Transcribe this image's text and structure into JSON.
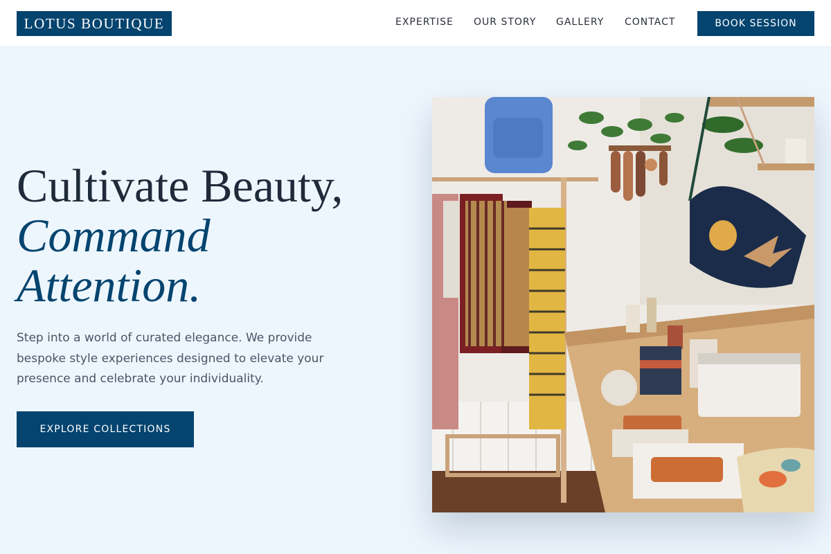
{
  "brand": {
    "name": "LOTUS BOUTIQUE"
  },
  "nav": {
    "items": [
      {
        "label": "EXPERTISE"
      },
      {
        "label": "OUR STORY"
      },
      {
        "label": "GALLERY"
      },
      {
        "label": "CONTACT"
      }
    ],
    "cta_label": "BOOK SESSION"
  },
  "hero": {
    "headline_line1": "Cultivate Beauty,",
    "headline_line2": "Command",
    "headline_line3": "Attention.",
    "description": "Step into a world of curated elegance. We provide bespoke style experiences designed to elevate your presence and celebrate your individuality.",
    "cta_label": "EXPLORE COLLECTIONS",
    "image_subject": "boutique interior with clothing rack, hanging bags and wooden display table"
  },
  "colors": {
    "brand": "#04446f",
    "page_background": "#eef6fd",
    "header_background": "#ffffff",
    "headline_text": "#1f2a3a",
    "body_text": "#4a5566"
  }
}
